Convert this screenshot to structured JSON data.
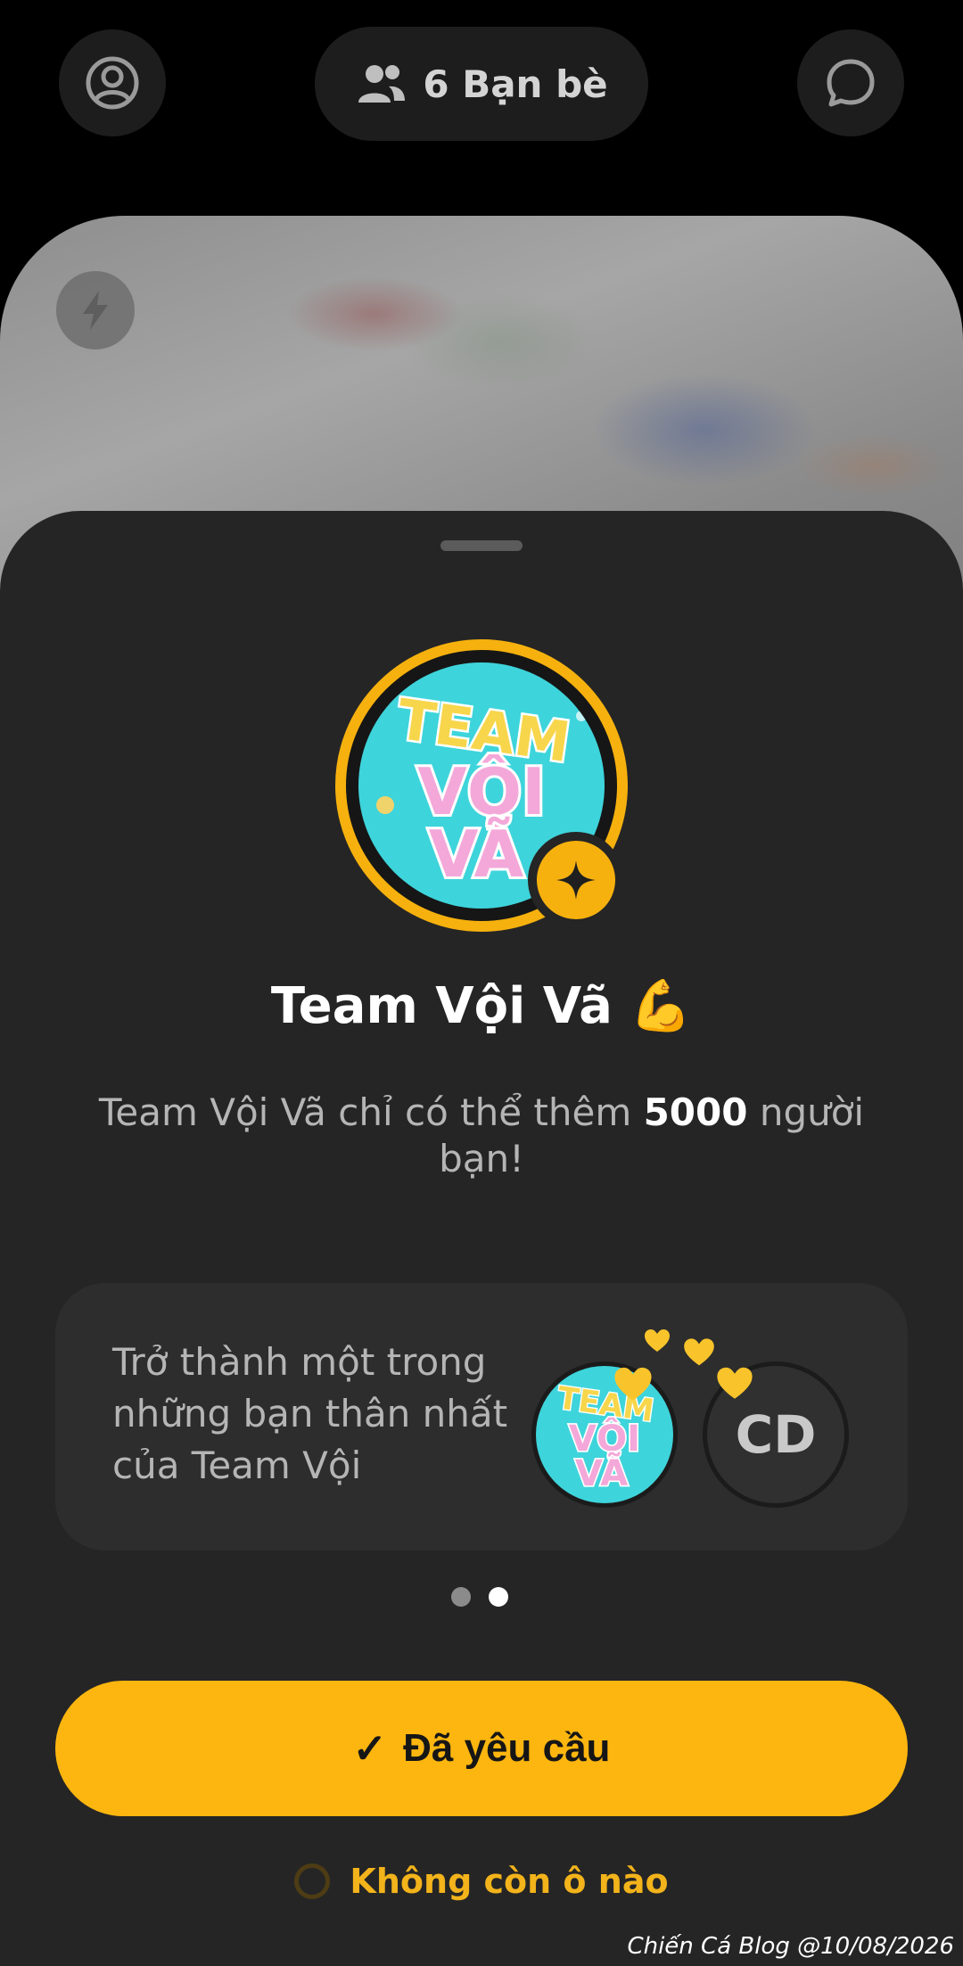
{
  "header": {
    "profile_icon": "user-circle-icon",
    "friends_icon": "users-icon",
    "friends_label": "6 Bạn bè",
    "chat_icon": "chat-bubble-icon"
  },
  "camera": {
    "flash_icon": "lightning-icon"
  },
  "group": {
    "logo_text": [
      "TEAM",
      "VỘI",
      "VÃ"
    ],
    "badge_icon": "sparkle-icon",
    "title": "Team Vội Vã 💪",
    "subtitle_before": "Team Vội Vã chỉ có thể thêm ",
    "subtitle_number": "5000",
    "subtitle_after": " người bạn!"
  },
  "best_friends_card": {
    "text": "Trở thành một trong những bạn thân nhất của Team Vội",
    "user_initials": "CD",
    "heart_icon": "yellow-heart-icon"
  },
  "pager": {
    "count": 2,
    "active_index": 1
  },
  "actions": {
    "requested_check": "✓",
    "requested_label": "Đã yêu cầu",
    "slots_label": "Không còn ô nào"
  },
  "watermark": "Chiến Cá Blog @10/08/2026",
  "colors": {
    "accent": "#fdb60f",
    "sheet_bg": "#252525",
    "card_bg": "#2d2d2d"
  }
}
